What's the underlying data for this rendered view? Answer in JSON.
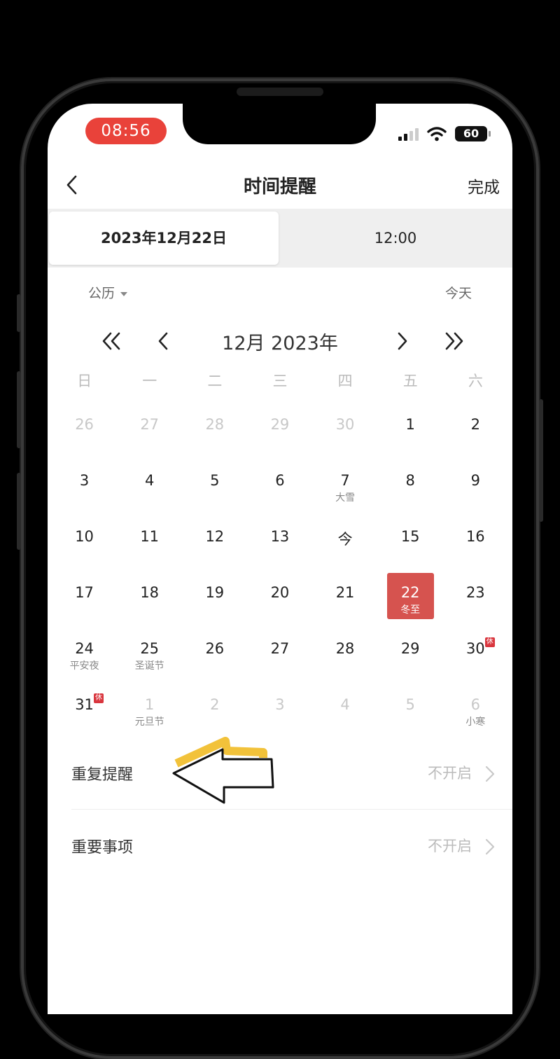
{
  "status_bar": {
    "time": "08:56",
    "battery": "60"
  },
  "nav": {
    "title": "时间提醒",
    "done": "完成"
  },
  "segment": {
    "date": "2023年12月22日",
    "time": "12:00"
  },
  "calendar_type": "公历",
  "today_label": "今天",
  "month_label": "12月 2023年",
  "weekdays": [
    "日",
    "一",
    "二",
    "三",
    "四",
    "五",
    "六"
  ],
  "weeks": [
    [
      {
        "n": "26",
        "dim": true
      },
      {
        "n": "27",
        "dim": true
      },
      {
        "n": "28",
        "dim": true
      },
      {
        "n": "29",
        "dim": true
      },
      {
        "n": "30",
        "dim": true
      },
      {
        "n": "1"
      },
      {
        "n": "2"
      }
    ],
    [
      {
        "n": "3"
      },
      {
        "n": "4"
      },
      {
        "n": "5"
      },
      {
        "n": "6"
      },
      {
        "n": "7",
        "sub": "大雪"
      },
      {
        "n": "8"
      },
      {
        "n": "9"
      }
    ],
    [
      {
        "n": "10"
      },
      {
        "n": "11"
      },
      {
        "n": "12"
      },
      {
        "n": "13"
      },
      {
        "n": "今"
      },
      {
        "n": "15"
      },
      {
        "n": "16"
      }
    ],
    [
      {
        "n": "17"
      },
      {
        "n": "18"
      },
      {
        "n": "19"
      },
      {
        "n": "20"
      },
      {
        "n": "21"
      },
      {
        "n": "22",
        "sub": "冬至",
        "selected": true
      },
      {
        "n": "23"
      }
    ],
    [
      {
        "n": "24",
        "sub": "平安夜"
      },
      {
        "n": "25",
        "sub": "圣诞节"
      },
      {
        "n": "26"
      },
      {
        "n": "27"
      },
      {
        "n": "28"
      },
      {
        "n": "29"
      },
      {
        "n": "30",
        "badge": "休"
      }
    ],
    [
      {
        "n": "31",
        "badge": "休"
      },
      {
        "n": "1",
        "dim": true,
        "sub": "元旦节"
      },
      {
        "n": "2",
        "dim": true
      },
      {
        "n": "3",
        "dim": true
      },
      {
        "n": "4",
        "dim": true
      },
      {
        "n": "5",
        "dim": true
      },
      {
        "n": "6",
        "dim": true,
        "sub": "小寒"
      }
    ]
  ],
  "options": [
    {
      "label": "重复提醒",
      "value": "不开启"
    },
    {
      "label": "重要事项",
      "value": "不开启"
    }
  ],
  "colors": {
    "accent": "#d6534f",
    "time_pill": "#e9423a",
    "holiday_badge": "#d9363e",
    "annotation_highlight": "#f2c23a"
  },
  "icons": {
    "back": "chevron-left-icon",
    "arrow": "chevron-right-icon"
  }
}
